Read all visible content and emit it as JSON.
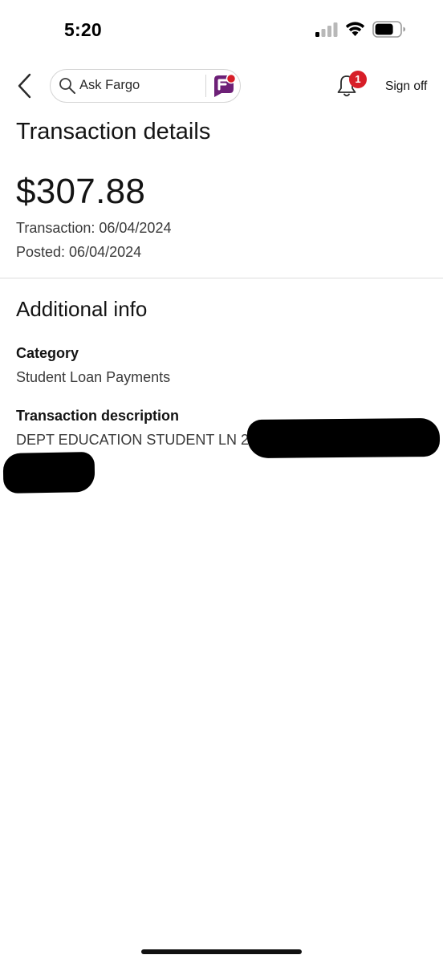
{
  "status_bar": {
    "time": "5:20"
  },
  "header": {
    "search_label": "Ask Fargo",
    "notification_count": "1",
    "sign_off_label": "Sign off"
  },
  "transaction": {
    "title": "Transaction details",
    "amount": "$307.88",
    "transaction_date": "Transaction: 06/04/2024",
    "posted_date": "Posted: 06/04/2024"
  },
  "additional_info": {
    "title": "Additional info",
    "category_label": "Category",
    "category_value": "Student Loan Payments",
    "description_label": "Transaction description",
    "description_value": "DEPT EDUCATION STUDENT LN 24"
  },
  "icons": {
    "back": "chevron-left-icon",
    "search": "search-icon",
    "assistant": "fargo-logo-icon",
    "notifications": "bell-icon"
  },
  "colors": {
    "badge": "#d71e28",
    "fargo_purple": "#6d2077",
    "fargo_red": "#d71e28",
    "divider": "#dcdcdc"
  }
}
